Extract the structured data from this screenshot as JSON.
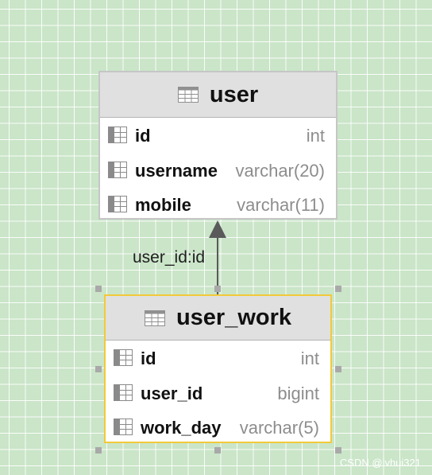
{
  "entities": {
    "user": {
      "title": "user",
      "columns": [
        {
          "name": "id",
          "type": "int"
        },
        {
          "name": "username",
          "type": "varchar(20)"
        },
        {
          "name": "mobile",
          "type": "varchar(11)"
        }
      ]
    },
    "user_work": {
      "title": "user_work",
      "columns": [
        {
          "name": "id",
          "type": "int"
        },
        {
          "name": "user_id",
          "type": "bigint"
        },
        {
          "name": "work_day",
          "type": "varchar(5)"
        }
      ]
    }
  },
  "relationship": {
    "label": "user_id:id",
    "from": "user_work",
    "to": "user"
  },
  "watermark": "CSDN @lvhui321",
  "colors": {
    "canvas_background": "#cae5c8",
    "grid_line": "#ffffff",
    "header_background": "#e0e0e0",
    "selected_border": "#f2c93a",
    "default_border": "#c6c6c6",
    "type_text": "#8d8d8d",
    "arrow": "#5a5a5a"
  }
}
